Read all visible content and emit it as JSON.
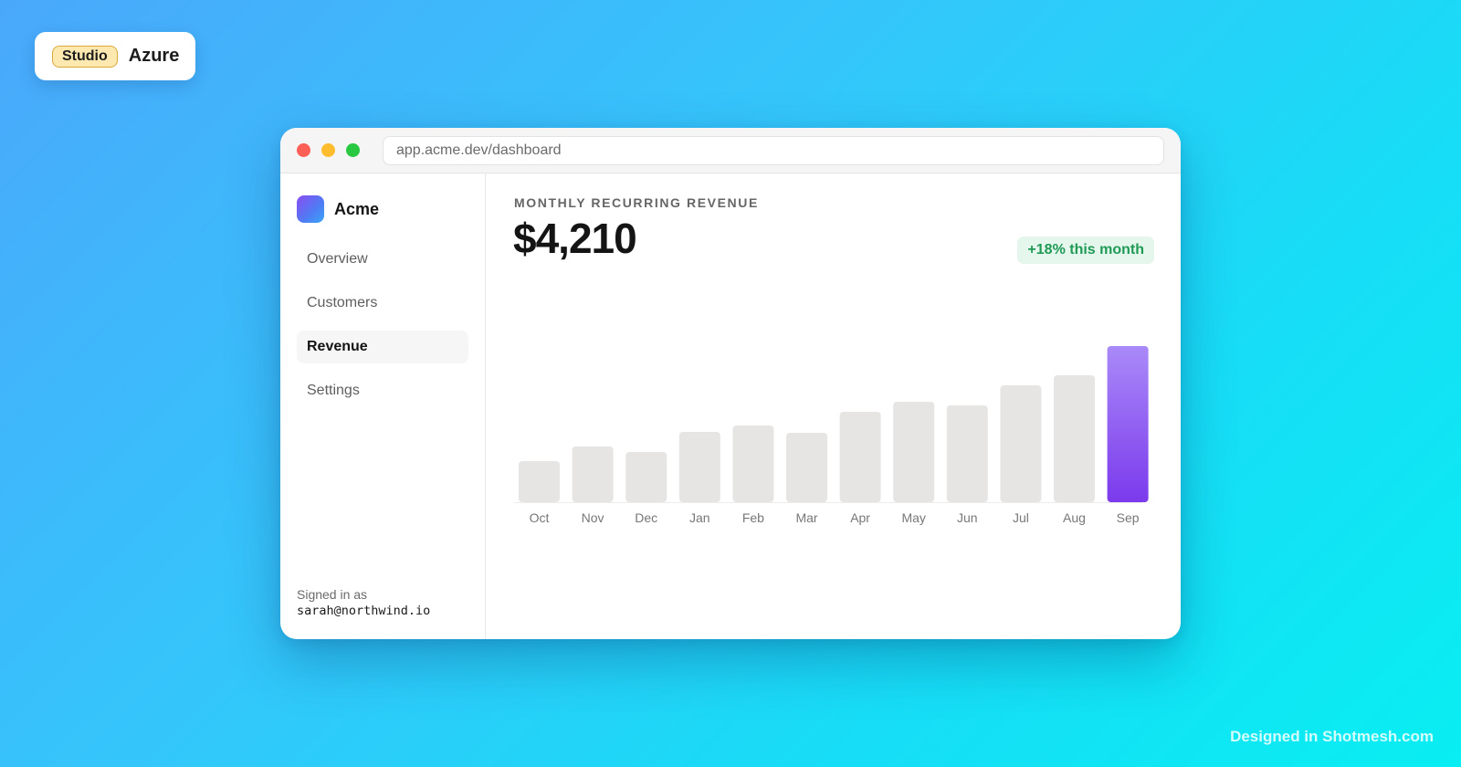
{
  "badge": {
    "pill": "Studio",
    "name": "Azure"
  },
  "window": {
    "url": "app.acme.dev/dashboard"
  },
  "sidebar": {
    "brand": "Acme",
    "items": [
      {
        "label": "Overview",
        "active": false
      },
      {
        "label": "Customers",
        "active": false
      },
      {
        "label": "Revenue",
        "active": true
      },
      {
        "label": "Settings",
        "active": false
      }
    ],
    "signed_in_label": "Signed in as",
    "email": "sarah@northwind.io"
  },
  "main": {
    "kpi_label": "MONTHLY RECURRING REVENUE",
    "kpi_value": "$4,210",
    "kpi_change": "+18% this month"
  },
  "chart_data": {
    "type": "bar",
    "categories": [
      "Oct",
      "Nov",
      "Dec",
      "Jan",
      "Feb",
      "Mar",
      "Apr",
      "May",
      "Jun",
      "Jul",
      "Aug",
      "Sep"
    ],
    "values": [
      45,
      61,
      55,
      77,
      84,
      76,
      99,
      110,
      106,
      128,
      139,
      171
    ],
    "highlight_index": 11,
    "colors": {
      "bar": "#e6e5e4",
      "highlight_top": "#a98af8",
      "highlight_bottom": "#7b3aec"
    }
  },
  "footer": {
    "credit": "Designed in Shotmesh.com"
  }
}
